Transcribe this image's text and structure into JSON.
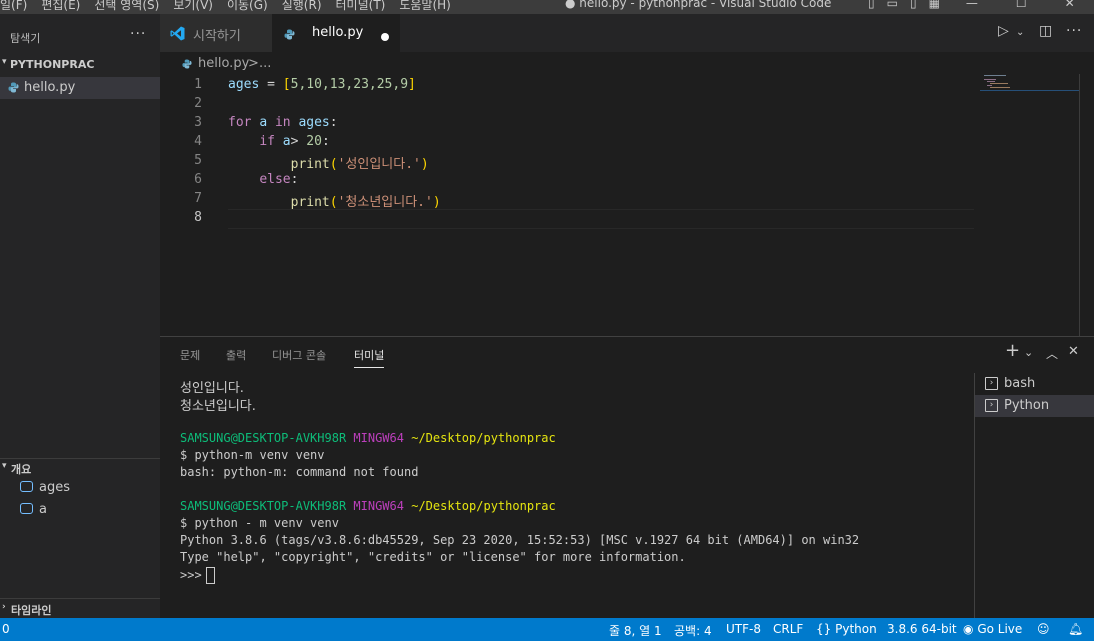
{
  "titlebar": {
    "menu": [
      "일(F)",
      "편집(E)",
      "선택 영역(S)",
      "보기(V)",
      "이동(G)",
      "실행(R)",
      "터미널(T)",
      "도움말(H)"
    ],
    "window_title": "● hello.py - pythonprac - Visual Studio Code"
  },
  "sidebar": {
    "title": "탐색기",
    "more": "···",
    "project": "PYTHONPRAC",
    "file": "hello.py",
    "outline_title": "개요",
    "outline_items": [
      "ages",
      "a"
    ],
    "timeline_title": "타임라인"
  },
  "tabs": [
    {
      "label": "시작하기",
      "active": false
    },
    {
      "label": "hello.py",
      "active": true,
      "modified": true
    }
  ],
  "breadcrumb": {
    "file": "hello.py",
    "sep": ">",
    "more": "..."
  },
  "editor": {
    "line_numbers": [
      "1",
      "2",
      "3",
      "4",
      "5",
      "6",
      "7",
      "8"
    ],
    "lines": [
      "ages = [5,10,13,23,25,9]",
      "",
      "for a in ages:",
      "    if a> 20:",
      "        print('성인입니다.')",
      "    else:",
      "        print('청소년입니다.')",
      ""
    ],
    "tokens": {
      "ages_var": "ages",
      "eq": " = ",
      "lb": "[",
      "nums": "5,10,13,23,25,9",
      "rb": "]",
      "for_kw": "for",
      "a_var": "a",
      "in_kw": "in",
      "ages_ref": "ages",
      "colon": ":",
      "if_kw": "if",
      "a_ref": "a",
      "gt": "> ",
      "twenty": "20",
      "print1": "print",
      "lp": "(",
      "str1": "'성인입니다.'",
      "rp": ")",
      "else_kw": "else",
      "print2": "print",
      "str2": "'청소년입니다.'"
    }
  },
  "panel": {
    "tabs": [
      "문제",
      "출력",
      "디버그 콘솔",
      "터미널"
    ],
    "active_tab": "터미널",
    "terminal": {
      "out1": "성인입니다.",
      "out2": "청소년입니다.",
      "user": "SAMSUNG@DESKTOP-AVKH98R",
      "shell": "MINGW64",
      "path": "~/Desktop/pythonprac",
      "cmd1": "$ python-m venv venv",
      "err1": "bash: python-m: command not found",
      "cmd2": "$ python - m venv venv",
      "py_ver": "Python 3.8.6 (tags/v3.8.6:db45529, Sep 23 2020, 15:52:53) [MSC v.1927 64 bit (AMD64)] on win32",
      "py_help": "Type \"help\", \"copyright\", \"credits\" or \"license\" for more information.",
      "prompt": ">>>"
    },
    "terminals": [
      "bash",
      "Python"
    ],
    "selected_terminal": "Python"
  },
  "statusbar": {
    "left": "0",
    "position": "줄 8, 열 1",
    "spaces": "공백: 4",
    "encoding": "UTF-8",
    "eol": "CRLF",
    "language": "Python",
    "interpreter": "3.8.6 64-bit",
    "golive": "Go Live"
  },
  "colors": {
    "accent": "#007acc",
    "keyword": "#c586c0",
    "variable": "#9cdcfe",
    "number": "#b5cea8",
    "function": "#dcdcaa",
    "string": "#ce9178",
    "term_green": "#0dbc79",
    "term_magenta": "#bc3fbc",
    "term_yellow": "#e5e510"
  }
}
